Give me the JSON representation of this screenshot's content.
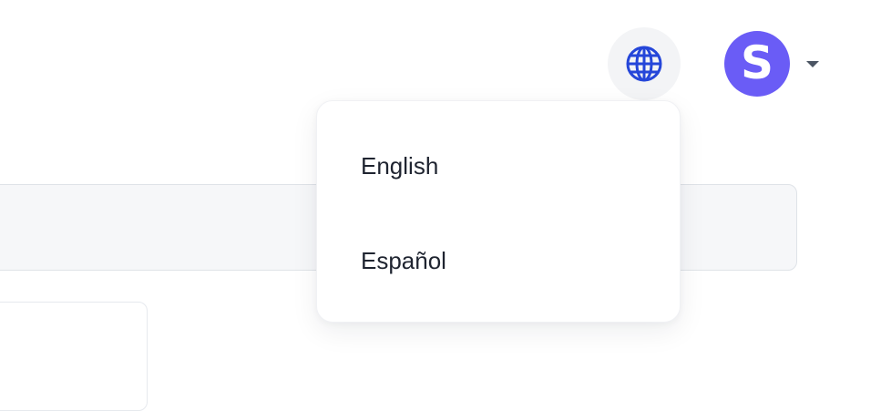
{
  "colors": {
    "avatar_bg": "#6a5cf6",
    "globe_icon": "#2546d9"
  },
  "header": {
    "language_icon": "globe-icon",
    "user": {
      "avatar_initial": "S",
      "menu_icon": "caret-down-icon"
    }
  },
  "language_menu": {
    "options": [
      {
        "label": "English"
      },
      {
        "label": "Español"
      }
    ]
  }
}
